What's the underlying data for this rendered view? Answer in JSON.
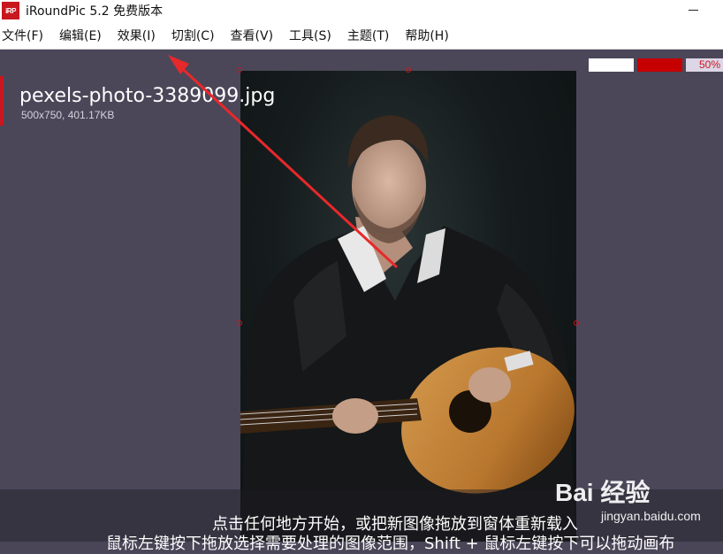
{
  "window": {
    "app_icon_text": "iRP",
    "title": "iRoundPic 5.2 免费版本"
  },
  "menu": [
    {
      "label": "文件(F)"
    },
    {
      "label": "编辑(E)"
    },
    {
      "label": "效果(I)"
    },
    {
      "label": "切割(C)"
    },
    {
      "label": "查看(V)"
    },
    {
      "label": "工具(S)"
    },
    {
      "label": "主题(T)"
    },
    {
      "label": "帮助(H)"
    }
  ],
  "file": {
    "name": "pexels-photo-3389099.jpg",
    "info": "500x750, 401.17KB"
  },
  "toolbar": {
    "zoom": "50%",
    "swatch_colors": [
      "#ffffff",
      "#c60000"
    ]
  },
  "hints": {
    "line1": "点击任何地方开始，或把新图像拖放到窗体重新载入",
    "line2": "鼠标左键按下拖放选择需要处理的图像范围，Shift + 鼠标左键按下可以拖动画布"
  },
  "watermark": {
    "brand": "Bai 经验",
    "url": "jingyan.baidu.com"
  },
  "colors": {
    "accent": "#c8171e",
    "workspace_bg": "#4b4759",
    "arrow": "#e8282b"
  }
}
